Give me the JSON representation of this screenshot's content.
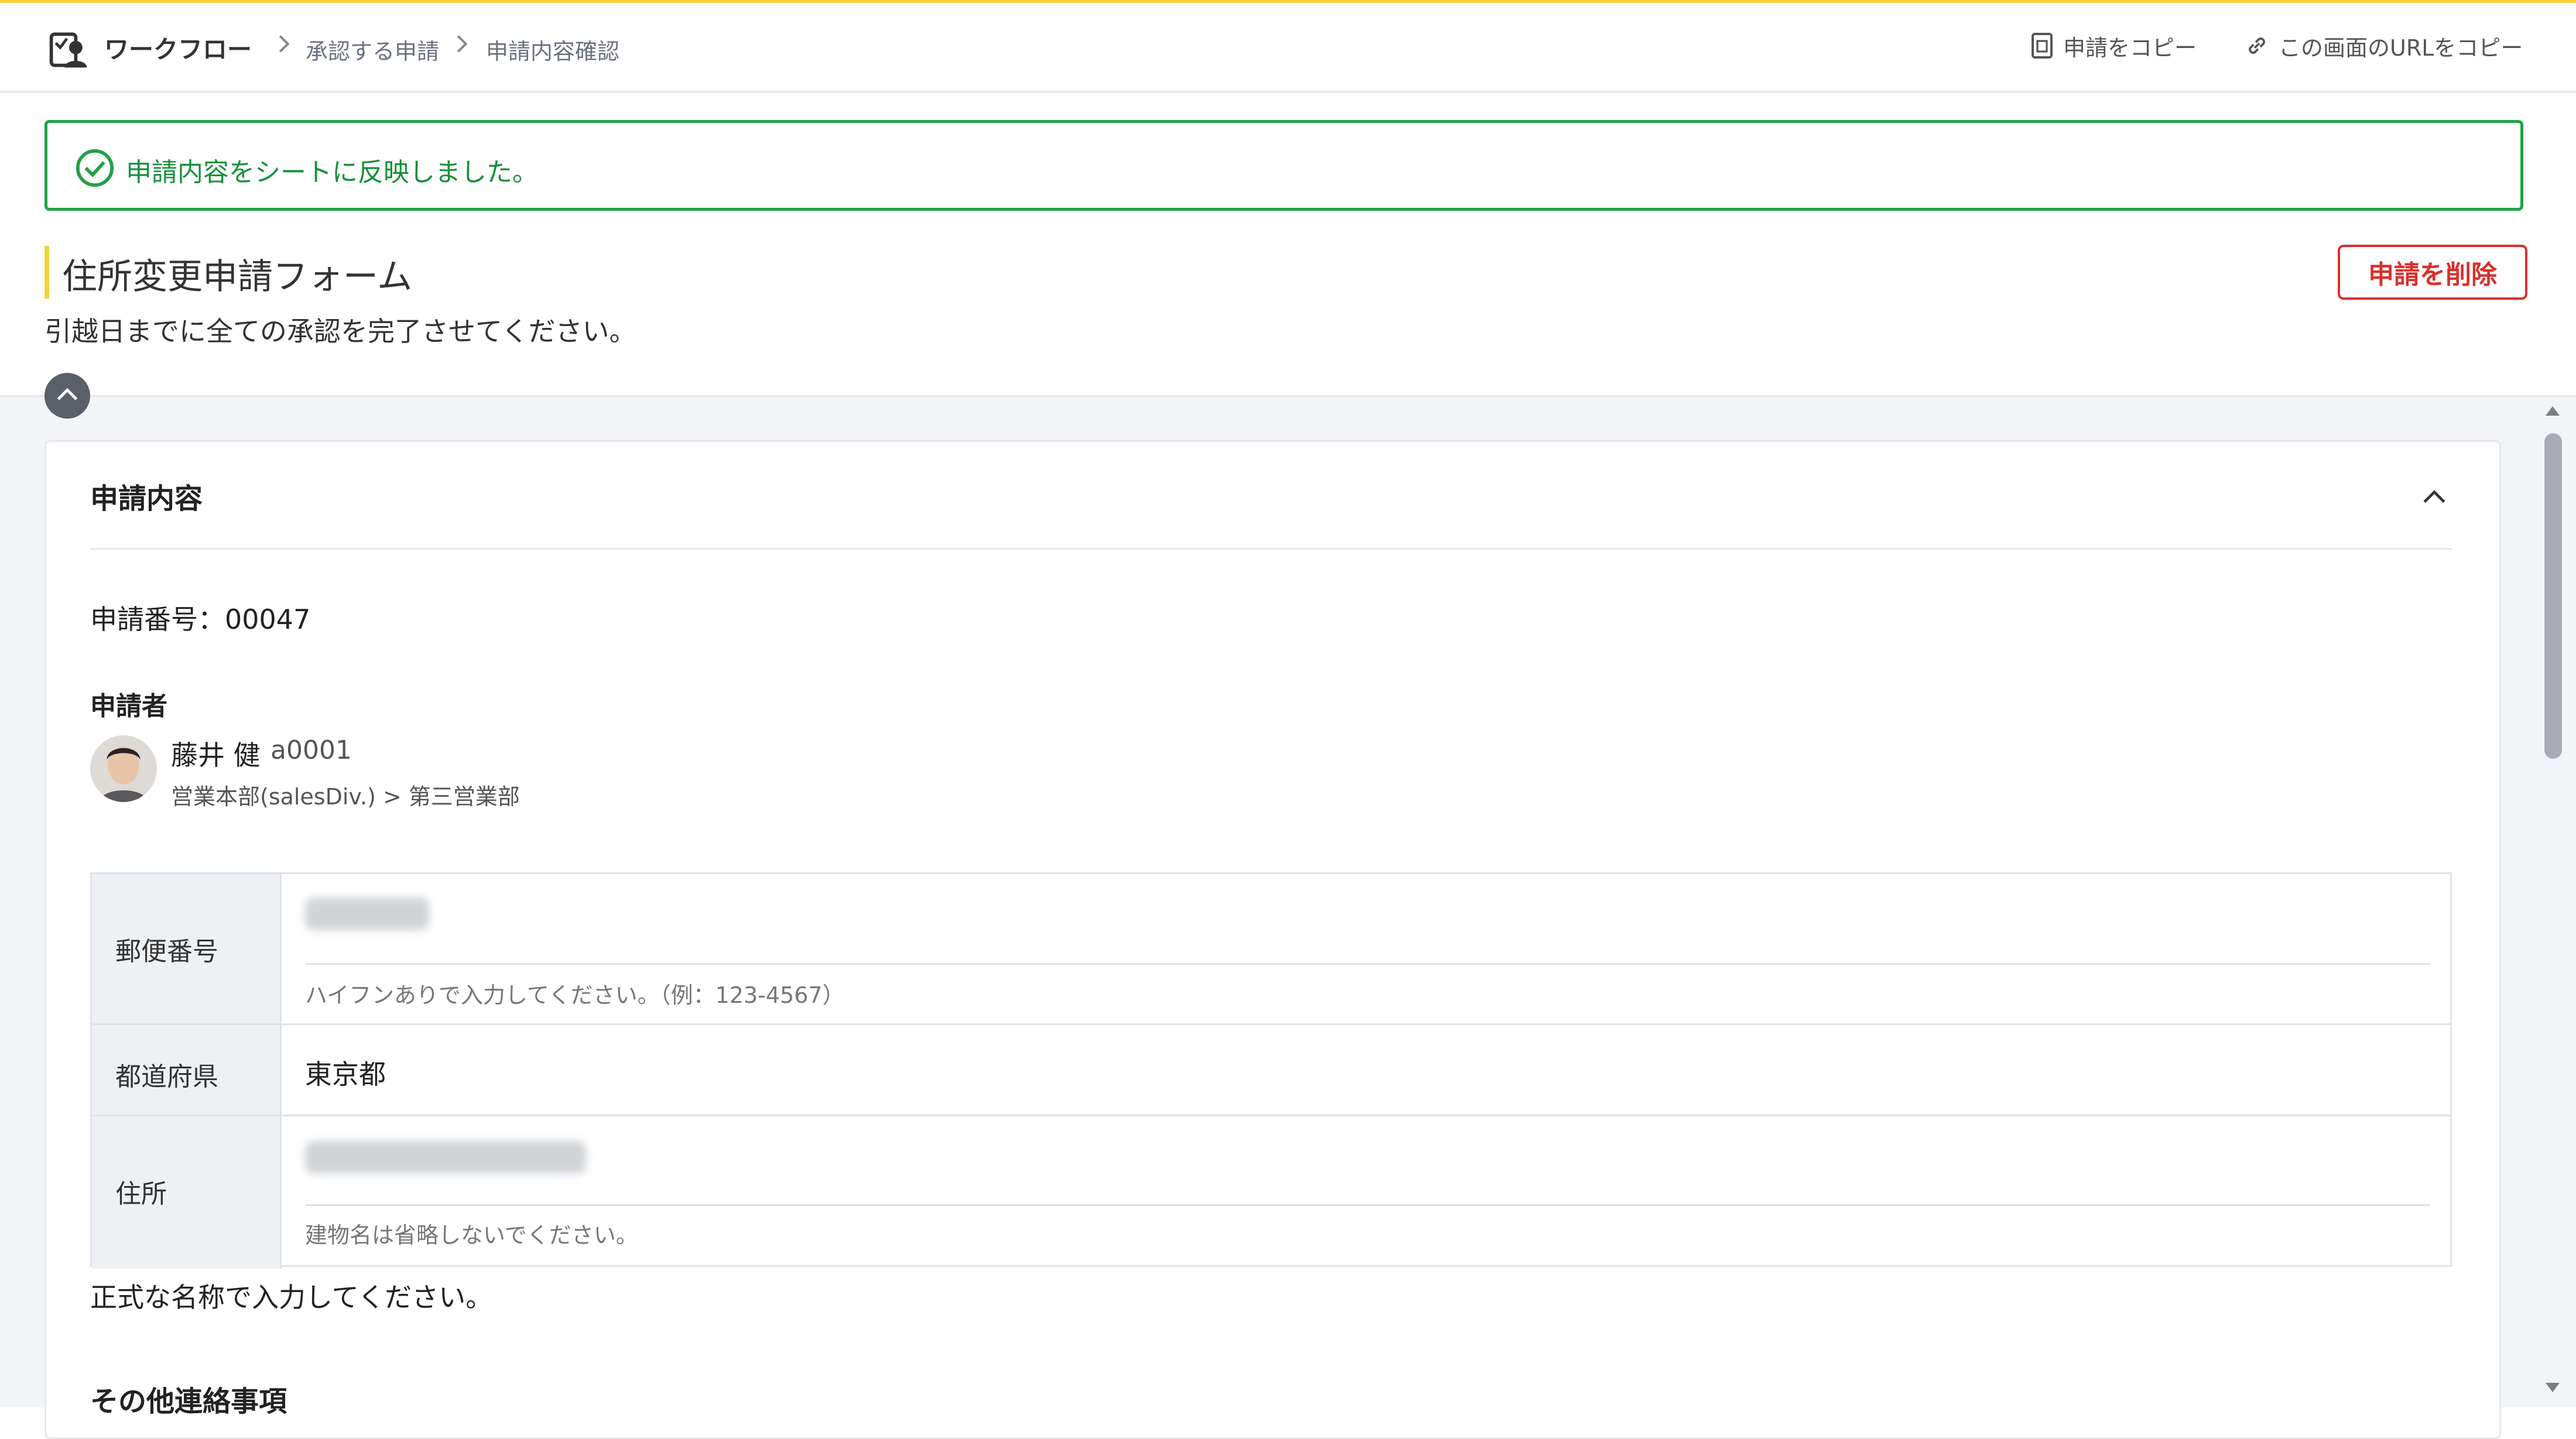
{
  "header": {
    "logo_icon": "workflow-logo-icon",
    "breadcrumb": [
      "ワークフロー",
      "承認する申請",
      "申請内容確認"
    ],
    "actions": [
      {
        "label": "申請をコピー",
        "icon": "copy-document-icon"
      },
      {
        "label": "この画面のURLをコピー",
        "icon": "link-icon"
      }
    ]
  },
  "alert": {
    "message": "申請内容をシートに反映しました。",
    "icon": "check-circle-icon",
    "color": "#22a046"
  },
  "form": {
    "title": "住所変更申請フォーム",
    "description": "引越日までに全ての承認を完了させてください。",
    "delete_label": "申請を削除",
    "accent": "#f2d33b",
    "danger": "#d9302c"
  },
  "section": {
    "title": "申請内容",
    "application_number": "申請番号：00047",
    "applicant_label": "申請者",
    "applicant": {
      "name": "藤井 健",
      "id": "a0001",
      "department": "営業本部(salesDiv.) > 第三営業部"
    },
    "fields": [
      {
        "label": "郵便番号",
        "value": "",
        "hint": "ハイフンありで入力してください。（例：123-4567）"
      },
      {
        "label": "都道府県",
        "value": "東京都"
      },
      {
        "label": "住所",
        "value": "",
        "hint": "建物名は省略しないでください。"
      }
    ],
    "note": "正式な名称で入力してください。",
    "next_section_title": "その他連絡事項"
  }
}
